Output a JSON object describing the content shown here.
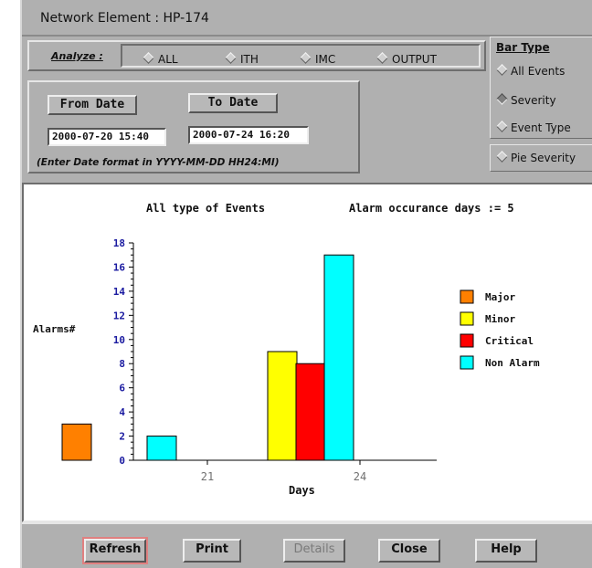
{
  "window": {
    "title": "Network Element : HP-174"
  },
  "analyze": {
    "label": "Analyze :",
    "options": [
      {
        "label": "ALL",
        "selected": false
      },
      {
        "label": "ITH",
        "selected": false
      },
      {
        "label": "IMC",
        "selected": false
      },
      {
        "label": "OUTPUT",
        "selected": false
      }
    ]
  },
  "bar_type": {
    "title": "Bar Type",
    "options": [
      {
        "label": "All Events",
        "selected": false
      },
      {
        "label": "Severity",
        "selected": true
      },
      {
        "label": "Event Type",
        "selected": false
      }
    ],
    "pie_label": "Pie Severity"
  },
  "dates": {
    "from_label": "From Date",
    "to_label": "To Date",
    "from_value": "2000-07-20 15:40",
    "to_value": "2000-07-24 16:20",
    "hint": "(Enter Date format in YYYY-MM-DD HH24:MI)"
  },
  "chart_data": {
    "type": "bar",
    "title": "All type of Events",
    "subtitle": "Alarm occurance days := 5",
    "xlabel": "Days",
    "ylabel": "Alarms#",
    "ylim": [
      0,
      18
    ],
    "yticks": [
      0,
      2,
      4,
      6,
      8,
      10,
      12,
      14,
      16,
      18
    ],
    "categories": [
      "21",
      "24"
    ],
    "series": [
      {
        "name": "Major",
        "color": "#ff8000",
        "values": [
          3,
          0
        ]
      },
      {
        "name": "Minor",
        "color": "#ffff00",
        "values": [
          0,
          9
        ]
      },
      {
        "name": "Critical",
        "color": "#ff0000",
        "values": [
          0,
          8
        ]
      },
      {
        "name": "Non Alarm",
        "color": "#00ffff",
        "values": [
          2,
          17
        ]
      }
    ],
    "legend_position": "right",
    "grid": false
  },
  "buttons": {
    "refresh": "Refresh",
    "print": "Print",
    "details": "Details",
    "close": "Close",
    "help": "Help"
  },
  "colors": {
    "panel": "#b0b0b0",
    "axis_tick_label": "#1a1aa0"
  }
}
